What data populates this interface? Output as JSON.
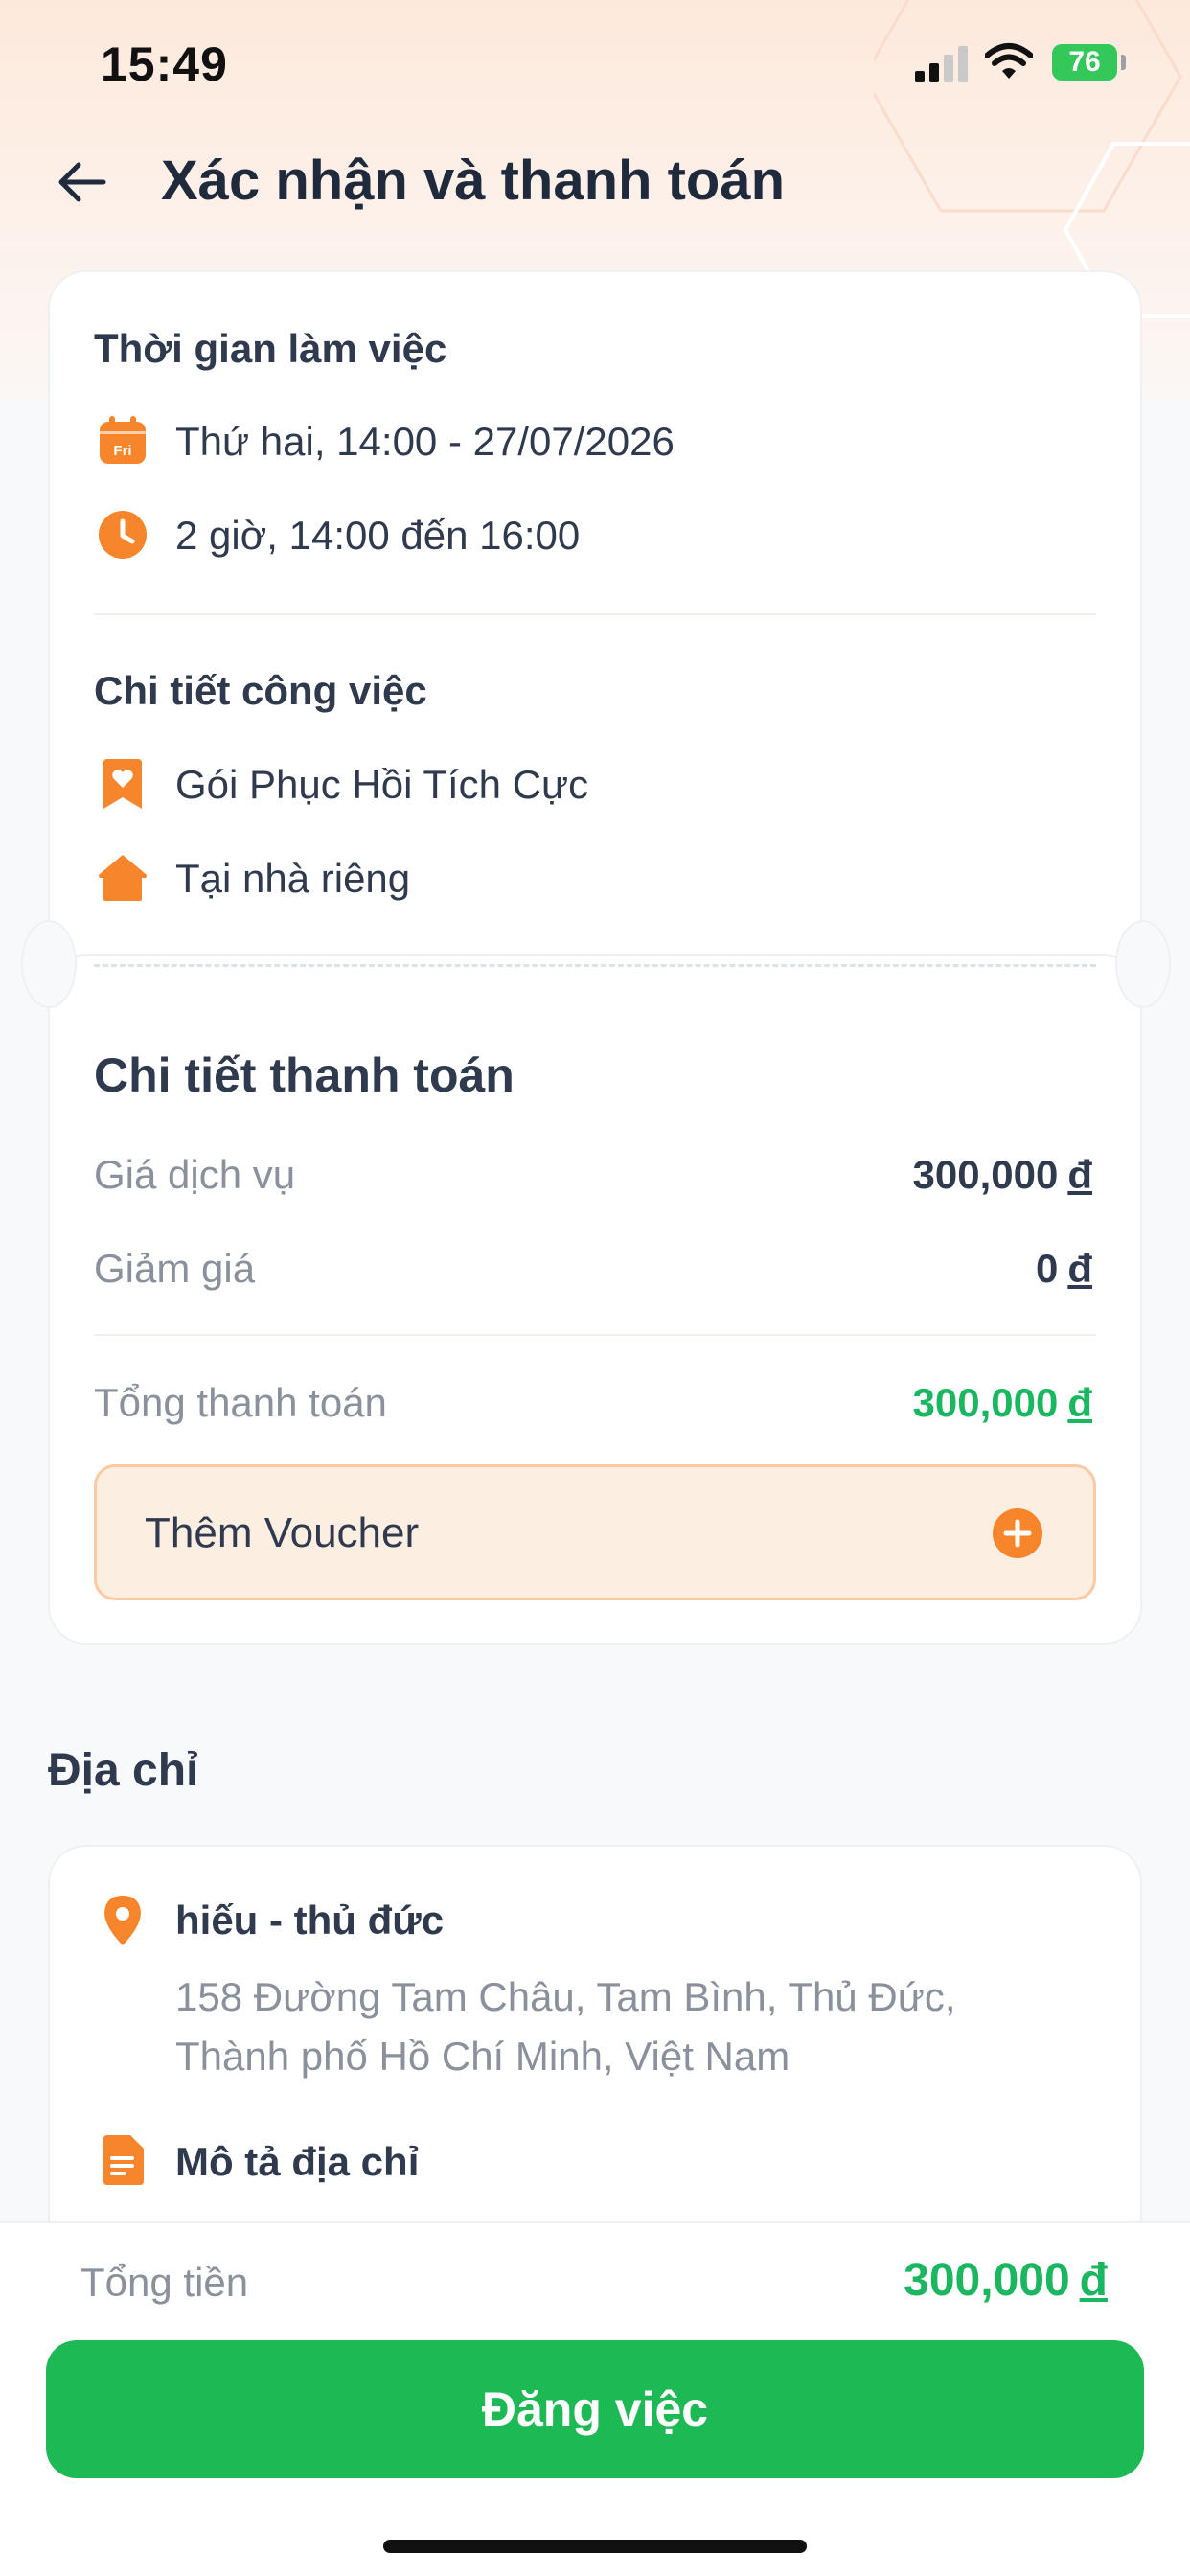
{
  "status_bar": {
    "time": "15:49",
    "battery": "76"
  },
  "header": {
    "title": "Xác nhận và thanh toán"
  },
  "work_time": {
    "title": "Thời gian làm việc",
    "date": "Thứ hai, 14:00 - 27/07/2026",
    "duration": "2 giờ, 14:00 đến 16:00",
    "calendar_icon_text": "Fri"
  },
  "job_details": {
    "title": "Chi tiết công việc",
    "package": "Gói Phục Hồi Tích Cực",
    "location": "Tại nhà riêng"
  },
  "payment": {
    "title": "Chi tiết thanh toán",
    "service_label": "Giá dịch vụ",
    "service_value": "300,000",
    "discount_label": "Giảm giá",
    "discount_value": "0",
    "total_label": "Tổng thanh toán",
    "total_value": "300,000",
    "currency": "đ",
    "voucher_label": "Thêm Voucher"
  },
  "address": {
    "heading": "Địa chỉ",
    "name": "hiếu - thủ đức",
    "line1": "158 Đường Tam Châu, Tam Bình, Thủ Đức,",
    "line2": "Thành phố Hồ Chí Minh, Việt Nam",
    "desc_title": "Mô tả địa chỉ"
  },
  "footer": {
    "total_label": "Tổng tiền",
    "total_value": "300,000",
    "currency": "đ",
    "submit_label": "Đăng việc"
  },
  "colors": {
    "accent_orange": "#f7852b",
    "green": "#1db954",
    "text_dark": "#2f3a4f",
    "text_muted": "#8a909c"
  },
  "icons": [
    "calendar-icon",
    "clock-icon",
    "bookmark-heart-icon",
    "home-icon",
    "plus-circle-icon",
    "location-pin-icon",
    "document-icon",
    "back-arrow-icon"
  ]
}
